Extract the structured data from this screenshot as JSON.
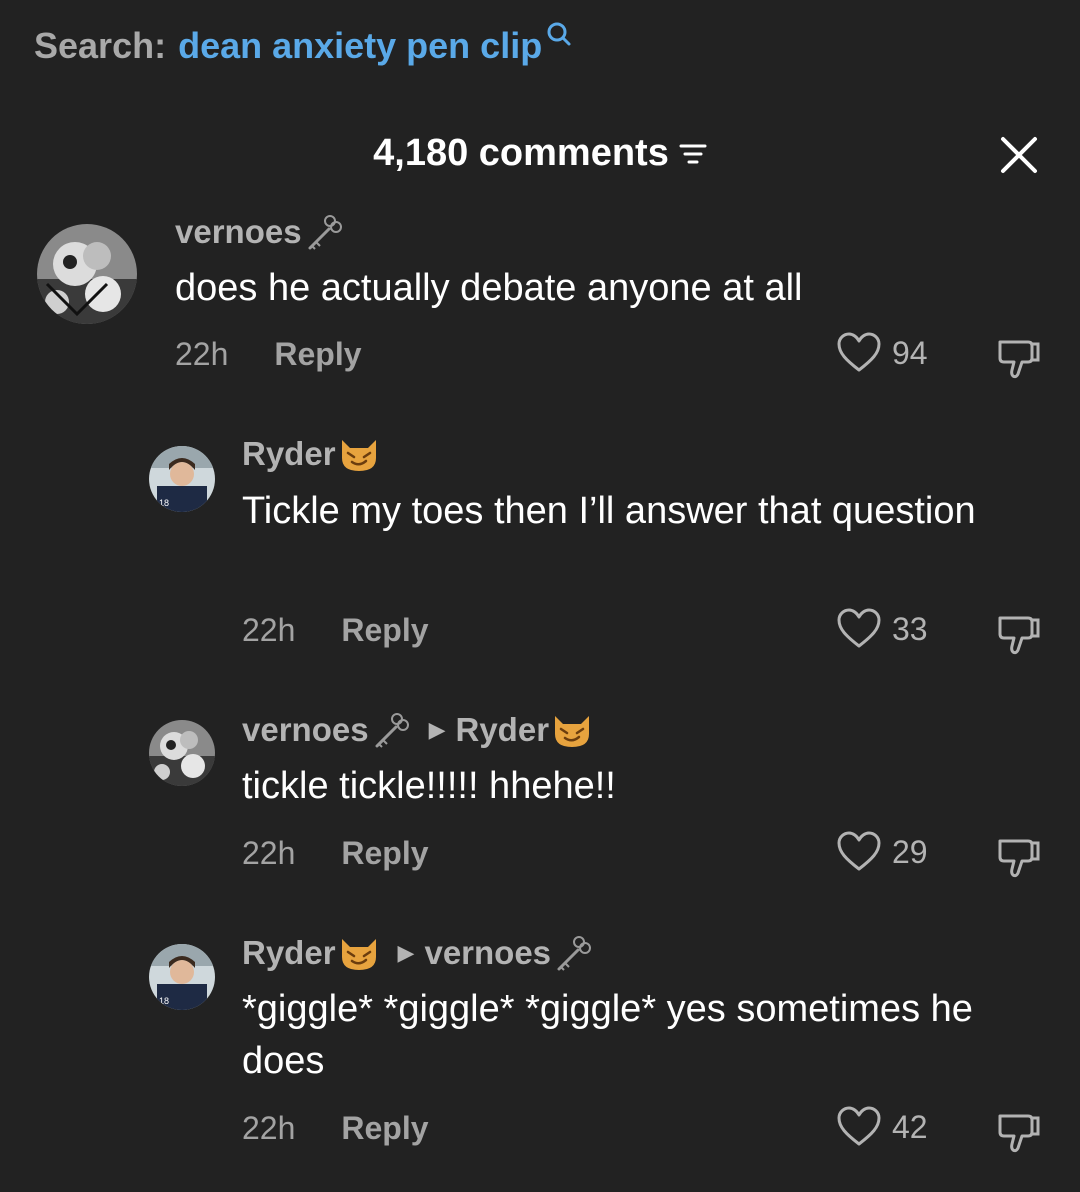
{
  "search": {
    "label": "Search:",
    "query": "dean anxiety pen clip"
  },
  "header": {
    "count_label": "4,180 comments"
  },
  "comments": [
    {
      "username": "vernoes",
      "text": "does he actually debate anyone at all",
      "time": "22h",
      "reply_label": "Reply",
      "likes": "94"
    },
    {
      "username": "Ryder",
      "text": "Tickle my toes then I’ll answer that question",
      "time": "22h",
      "reply_label": "Reply",
      "likes": "33"
    },
    {
      "username": "vernoes",
      "reply_to": "Ryder",
      "text": "tickle tickle!!!!! hhehe!!",
      "time": "22h",
      "reply_label": "Reply",
      "likes": "29"
    },
    {
      "username": "Ryder",
      "reply_to": "vernoes",
      "text": "*giggle* *giggle* *giggle* yes sometimes he does",
      "time": "22h",
      "reply_label": "Reply",
      "likes": "42"
    }
  ],
  "icons": {
    "search": "search-icon",
    "sort": "sort-icon",
    "close": "close-icon",
    "key": "key-icon",
    "cat": "cat-emoji-icon",
    "heart": "heart-icon",
    "dislike": "dislike-icon"
  },
  "colors": {
    "background": "#222222",
    "link": "#5aa9e8",
    "muted": "#a3a3a3"
  }
}
